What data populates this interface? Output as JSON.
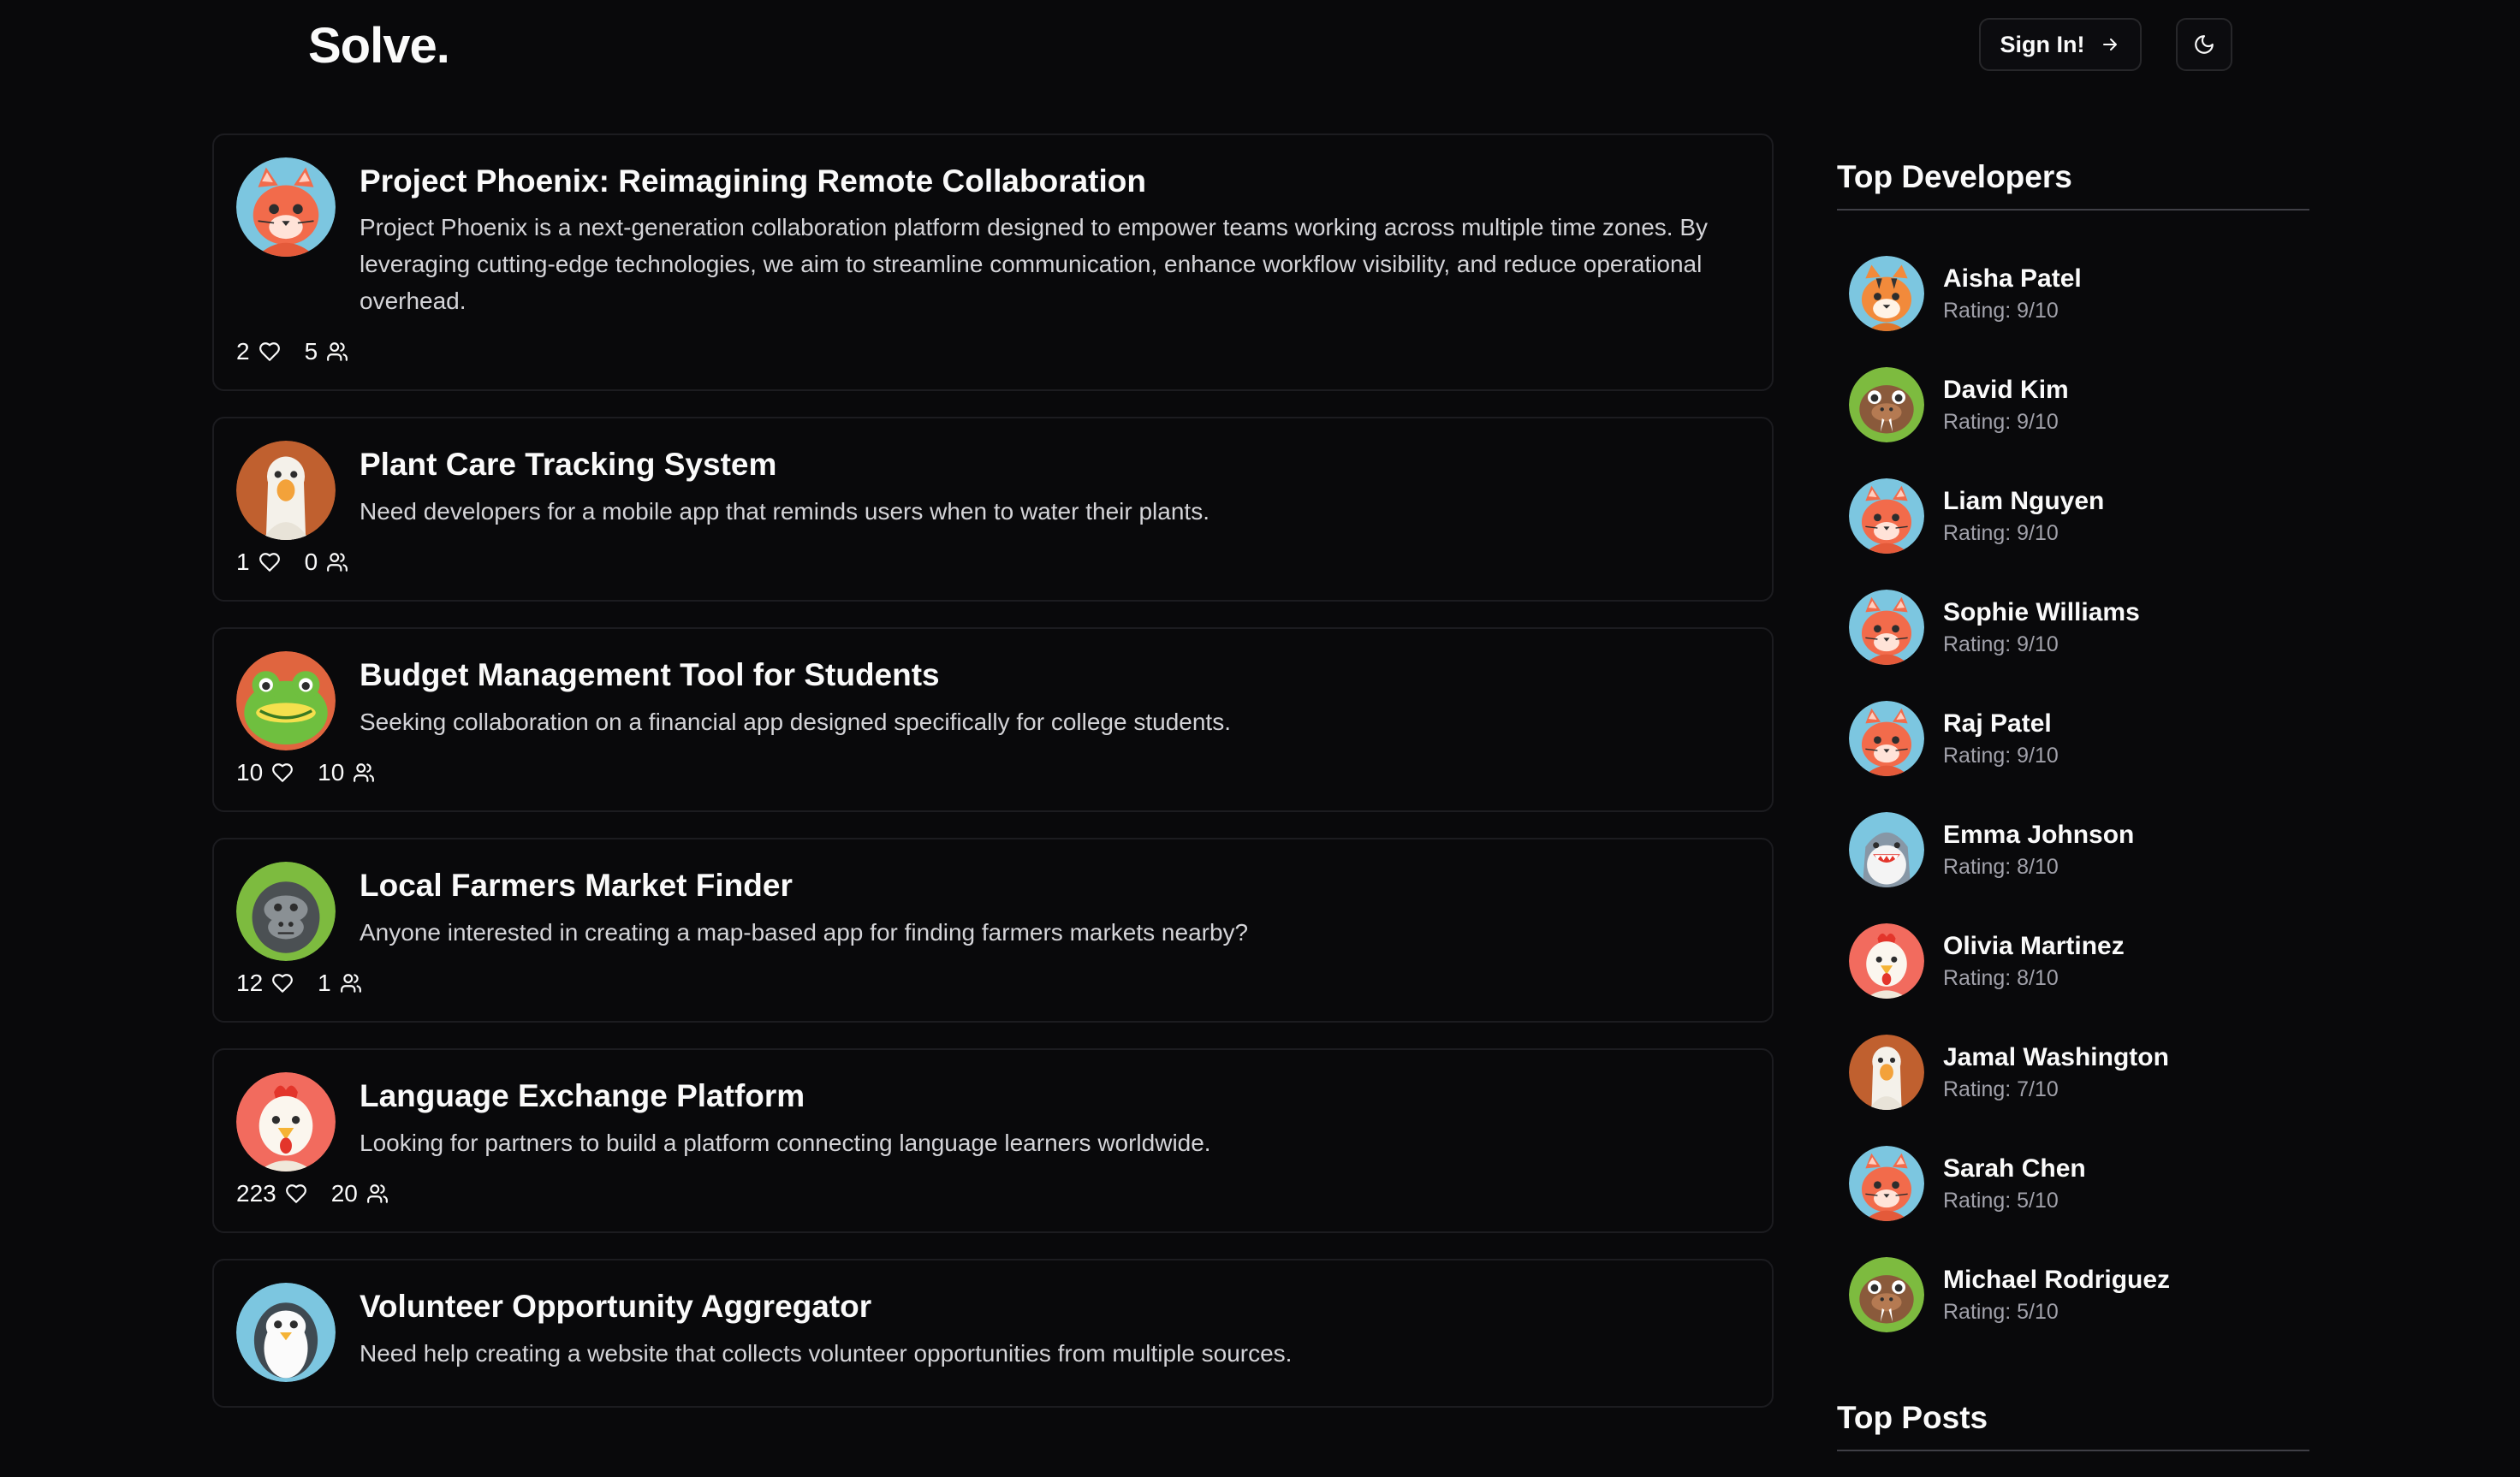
{
  "header": {
    "logo": "Solve.",
    "signin_label": "Sign In!",
    "signin_icon": "arrow-right-icon",
    "theme_icon": "moon-icon"
  },
  "posts": [
    {
      "title": "Project Phoenix: Reimagining Remote Collaboration",
      "description": "Project Phoenix is a next-generation collaboration platform designed to empower teams working across multiple time zones. By leveraging cutting-edge technologies, we aim to streamline communication, enhance workflow visibility, and reduce operational overhead.",
      "likes": "2",
      "members": "5",
      "avatar": "cat-avatar-icon"
    },
    {
      "title": "Plant Care Tracking System",
      "description": "Need developers for a mobile app that reminds users when to water their plants.",
      "likes": "1",
      "members": "0",
      "avatar": "goose-avatar-icon"
    },
    {
      "title": "Budget Management Tool for Students",
      "description": "Seeking collaboration on a financial app designed specifically for college students.",
      "likes": "10",
      "members": "10",
      "avatar": "frog-avatar-icon"
    },
    {
      "title": "Local Farmers Market Finder",
      "description": "Anyone interested in creating a map-based app for finding farmers markets nearby?",
      "likes": "12",
      "members": "1",
      "avatar": "gorilla-avatar-icon"
    },
    {
      "title": "Language Exchange Platform",
      "description": "Looking for partners to build a platform connecting language learners worldwide.",
      "likes": "223",
      "members": "20",
      "avatar": "chicken-avatar-icon"
    },
    {
      "title": "Volunteer Opportunity Aggregator",
      "description": "Need help creating a website that collects volunteer opportunities from multiple sources.",
      "likes": "",
      "members": "",
      "avatar": "penguin-avatar-icon"
    }
  ],
  "sidebar": {
    "top_developers_heading": "Top Developers",
    "top_posts_heading": "Top Posts",
    "developers": [
      {
        "name": "Aisha Patel",
        "rating": "Rating: 9/10",
        "avatar": "tiger-avatar-icon"
      },
      {
        "name": "David Kim",
        "rating": "Rating: 9/10",
        "avatar": "walrus-avatar-icon"
      },
      {
        "name": "Liam Nguyen",
        "rating": "Rating: 9/10",
        "avatar": "cat-avatar-icon"
      },
      {
        "name": "Sophie Williams",
        "rating": "Rating: 9/10",
        "avatar": "cat-avatar-icon"
      },
      {
        "name": "Raj Patel",
        "rating": "Rating: 9/10",
        "avatar": "cat-avatar-icon"
      },
      {
        "name": "Emma Johnson",
        "rating": "Rating: 8/10",
        "avatar": "shark-avatar-icon"
      },
      {
        "name": "Olivia Martinez",
        "rating": "Rating: 8/10",
        "avatar": "chicken-avatar-icon"
      },
      {
        "name": "Jamal Washington",
        "rating": "Rating: 7/10",
        "avatar": "goose-avatar-icon"
      },
      {
        "name": "Sarah Chen",
        "rating": "Rating: 5/10",
        "avatar": "cat-avatar-icon"
      },
      {
        "name": "Michael Rodriguez",
        "rating": "Rating: 5/10",
        "avatar": "walrus-avatar-icon"
      }
    ]
  },
  "colors": {
    "background": "#09090b",
    "border": "#1c1c20",
    "text": "#fafafa",
    "muted": "#a1a1aa"
  }
}
